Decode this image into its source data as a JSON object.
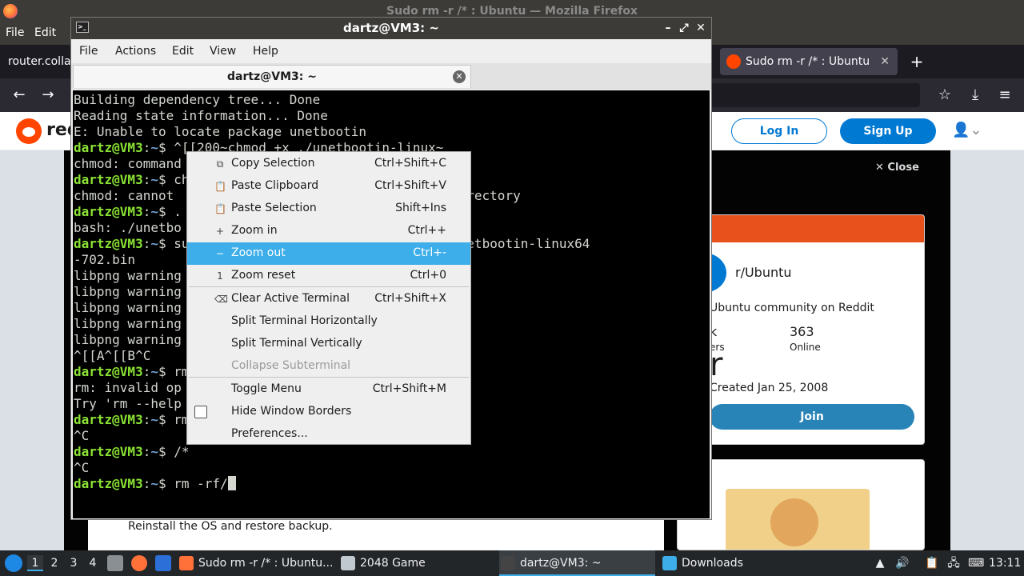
{
  "firefox": {
    "window_title": "Sudo rm -r /* : Ubuntu — Mozilla Firefox",
    "menu": [
      "File",
      "Edit"
    ],
    "left_tab_text": "router.colla",
    "active_tab": "Sudo rm -r /* : Ubuntu",
    "tab_close": "✕",
    "new_tab": "+",
    "nav": {
      "back": "←",
      "forward": "→",
      "bookmark": "☆",
      "download": "⤓",
      "menu": "≡"
    }
  },
  "reddit": {
    "logo_text": "red",
    "login": "Log In",
    "signup": "Sign Up",
    "close": "Close",
    "subreddit": "r/Ubuntu",
    "description": "Ubuntu community on Reddit",
    "members_value": "k",
    "members_label": "ers",
    "online_value": "363",
    "online_label": "Online",
    "big_letter": "r",
    "created": "Created Jan 25, 2008",
    "join": "Join",
    "post_text": "Reinstall the OS and restore backup."
  },
  "terminal": {
    "window_title": "dartz@VM3: ~",
    "menu": [
      "File",
      "Actions",
      "Edit",
      "View",
      "Help"
    ],
    "tab_title": "dartz@VM3: ~",
    "lines": [
      {
        "text": "Building dependency tree... Done"
      },
      {
        "text": "Reading state information... Done"
      },
      {
        "text": "E: Unable to locate package unetbootin"
      },
      {
        "prompt": "dartz@VM3",
        "path": "~",
        "text": "$ ^[[200~chmod +x ./unetbootin-linux~"
      },
      {
        "text": "chmod: command"
      },
      {
        "prompt": "dartz@VM3",
        "path": "~",
        "text": "$ ch"
      },
      {
        "text": "chmod: cannot                            file or directory"
      },
      {
        "prompt": "dartz@VM3",
        "path": "~",
        "text": "$ ."
      },
      {
        "text": "bash: ./unetbo                           y"
      },
      {
        "prompt": "dartz@VM3",
        "path": "~",
        "text": "$ su                         ownloads/unetbootin-linux64"
      },
      {
        "text": "-702.bin"
      },
      {
        "text": "libpng warning"
      },
      {
        "text": "libpng warning"
      },
      {
        "text": "libpng warning"
      },
      {
        "text": "libpng warning"
      },
      {
        "text": "libpng warning"
      },
      {
        "text": "^[[A^[[B^C"
      },
      {
        "prompt": "dartz@VM3",
        "path": "~",
        "text": "$ rm"
      },
      {
        "text": "rm: invalid op"
      },
      {
        "text": "Try 'rm --help"
      },
      {
        "prompt": "dartz@VM3",
        "path": "~",
        "text": "$ rm"
      },
      {
        "text": "^C"
      },
      {
        "prompt": "dartz@VM3",
        "path": "~",
        "text": "$ /*"
      },
      {
        "text": "^C"
      },
      {
        "prompt": "dartz@VM3",
        "path": "~",
        "text": "$ rm -rf/",
        "cursor": true
      }
    ]
  },
  "context_menu": {
    "items": [
      {
        "icon": "⧉",
        "label": "Copy Selection",
        "shortcut": "Ctrl+Shift+C"
      },
      {
        "icon": "📋",
        "label": "Paste Clipboard",
        "shortcut": "Ctrl+Shift+V"
      },
      {
        "icon": "📋",
        "label": "Paste Selection",
        "shortcut": "Shift+Ins"
      },
      {
        "icon": "+",
        "label": "Zoom in",
        "shortcut": "Ctrl++"
      },
      {
        "icon": "−",
        "label": "Zoom out",
        "shortcut": "Ctrl+-",
        "highlighted": true
      },
      {
        "icon": "1",
        "label": "Zoom reset",
        "shortcut": "Ctrl+0"
      },
      {
        "icon": "⌫",
        "label": "Clear Active Terminal",
        "shortcut": "Ctrl+Shift+X"
      },
      {
        "icon": "",
        "label": "Split Terminal Horizontally",
        "shortcut": ""
      },
      {
        "icon": "",
        "label": "Split Terminal Vertically",
        "shortcut": ""
      },
      {
        "icon": "",
        "label": "Collapse Subterminal",
        "shortcut": "",
        "disabled": true
      },
      {
        "icon": "",
        "label": "Toggle Menu",
        "shortcut": "Ctrl+Shift+M"
      },
      {
        "icon": "",
        "label": "Hide Window Borders",
        "shortcut": "",
        "checkbox": true
      },
      {
        "icon": "",
        "label": "Preferences...",
        "shortcut": ""
      }
    ]
  },
  "taskbar": {
    "desktops": [
      "1",
      "2",
      "3",
      "4"
    ],
    "tasks": [
      {
        "label": "Sudo rm -r /* : Ubuntu...",
        "icon_color": "#ff7139"
      },
      {
        "label": "2048 Game",
        "icon_color": "#c0c8d0"
      },
      {
        "label": "dartz@VM3: ~",
        "icon_color": "#444444",
        "active": true
      },
      {
        "label": "Downloads",
        "icon_color": "#3daee9"
      }
    ],
    "clock": "13:11"
  }
}
